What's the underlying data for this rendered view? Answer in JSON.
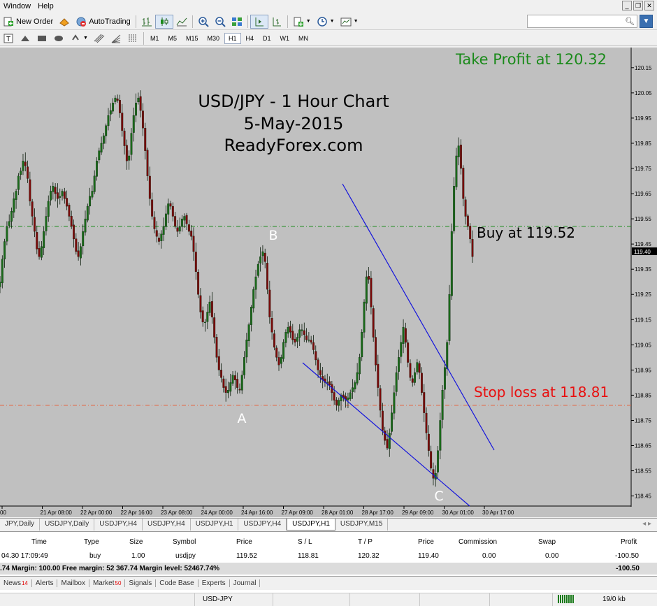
{
  "menu": {
    "items": [
      "Window",
      "Help"
    ]
  },
  "toolbar": {
    "new_order": "New Order",
    "auto_trading": "AutoTrading"
  },
  "timeframes": [
    {
      "label": "M1",
      "active": false
    },
    {
      "label": "M5",
      "active": false
    },
    {
      "label": "M15",
      "active": false
    },
    {
      "label": "M30",
      "active": false
    },
    {
      "label": "H1",
      "active": true
    },
    {
      "label": "H4",
      "active": false
    },
    {
      "label": "D1",
      "active": false
    },
    {
      "label": "W1",
      "active": false
    },
    {
      "label": "MN",
      "active": false
    }
  ],
  "chart": {
    "title_lines": [
      "USD/JPY - 1 Hour Chart",
      "5-May-2015",
      "ReadyForex.com"
    ],
    "take_profit": "Take Profit at 120.32",
    "buy": "Buy at 119.52",
    "stop_loss": "Stop loss at 118.81",
    "point_labels": [
      "A",
      "B",
      "C"
    ],
    "current_price": "119.40",
    "colors": {
      "background": "#c0c0c0",
      "take_profit": "#1a8a1a",
      "buy_line": "#1a8a1a",
      "stop_line": "#e8603a",
      "stop_text": "#e81010",
      "channel": "#1414dc",
      "bull": "#1a6a1a",
      "bear": "#7a0a0a"
    }
  },
  "chart_data": {
    "type": "candlestick",
    "symbol": "USDJPY",
    "timeframe": "H1",
    "y_ticks": [
      "120.15",
      "120.05",
      "119.95",
      "119.85",
      "119.75",
      "119.65",
      "119.55",
      "119.45",
      "119.35",
      "119.25",
      "119.15",
      "119.05",
      "118.95",
      "118.85",
      "118.75",
      "118.65",
      "118.55",
      "118.45"
    ],
    "x_ticks": [
      "00",
      "21 Apr 08:00",
      "22 Apr 00:00",
      "22 Apr 16:00",
      "23 Apr 08:00",
      "24 Apr 00:00",
      "24 Apr 16:00",
      "27 Apr 09:00",
      "28 Apr 01:00",
      "28 Apr 17:00",
      "29 Apr 09:00",
      "30 Apr 01:00",
      "30 Apr 17:00"
    ],
    "ylim": [
      118.41,
      120.23
    ],
    "levels": {
      "take_profit": 120.32,
      "buy": 119.52,
      "stop_loss": 118.81,
      "last": 119.4
    },
    "closes": [
      119.3,
      119.39,
      119.46,
      119.52,
      119.54,
      119.58,
      119.63,
      119.66,
      119.72,
      119.74,
      119.78,
      119.76,
      119.71,
      119.62,
      119.56,
      119.5,
      119.43,
      119.4,
      119.44,
      119.5,
      119.56,
      119.62,
      119.66,
      119.68,
      119.65,
      119.63,
      119.64,
      119.66,
      119.63,
      119.6,
      119.56,
      119.52,
      119.47,
      119.42,
      119.4,
      119.44,
      119.5,
      119.55,
      119.6,
      119.64,
      119.66,
      119.72,
      119.78,
      119.82,
      119.85,
      119.88,
      119.92,
      119.96,
      119.98,
      120.01,
      120.03,
      120.02,
      119.97,
      119.9,
      119.84,
      119.78,
      119.8,
      119.89,
      119.96,
      120.01,
      120.03,
      119.98,
      119.91,
      119.82,
      119.72,
      119.63,
      119.56,
      119.51,
      119.48,
      119.46,
      119.49,
      119.52,
      119.57,
      119.61,
      119.6,
      119.56,
      119.52,
      119.5,
      119.52,
      119.55,
      119.56,
      119.53,
      119.5,
      119.48,
      119.42,
      119.34,
      119.25,
      119.18,
      119.14,
      119.14,
      119.18,
      119.22,
      119.16,
      119.08,
      119.0,
      118.95,
      118.92,
      118.88,
      118.86,
      118.87,
      118.9,
      118.93,
      118.91,
      118.88,
      118.87,
      118.93,
      119.0,
      119.07,
      119.13,
      119.2,
      119.27,
      119.32,
      119.37,
      119.4,
      119.42,
      119.38,
      119.27,
      119.16,
      119.1,
      119.04,
      119.0,
      118.97,
      119.0,
      119.06,
      119.1,
      119.12,
      119.1,
      119.07,
      119.06,
      119.08,
      119.11,
      119.11,
      119.09,
      119.07,
      119.07,
      119.06,
      119.03,
      118.99,
      118.95,
      118.93,
      118.91,
      118.9,
      118.9,
      118.89,
      118.86,
      118.83,
      118.81,
      118.83,
      118.85,
      118.84,
      118.83,
      118.84,
      118.86,
      118.88,
      118.9,
      118.94,
      119.0,
      119.1,
      119.22,
      119.32,
      119.31,
      119.2,
      119.08,
      118.97,
      118.88,
      118.79,
      118.71,
      118.67,
      118.64,
      118.7,
      118.78,
      118.86,
      118.94,
      119.0,
      119.06,
      119.12,
      119.06,
      118.98,
      118.92,
      118.9,
      118.94,
      118.98,
      118.94,
      118.86,
      118.78,
      118.7,
      118.63,
      118.56,
      118.52,
      118.54,
      118.63,
      118.75,
      118.87,
      118.96,
      119.06,
      119.25,
      119.5,
      119.68,
      119.8,
      119.84,
      119.75,
      119.63,
      119.56,
      119.52,
      119.47,
      119.4
    ]
  },
  "chart_tabs": [
    {
      "label": "JPY,Daily",
      "active": false
    },
    {
      "label": "USDJPY,Daily",
      "active": false
    },
    {
      "label": "USDJPY,H4",
      "active": false
    },
    {
      "label": "USDJPY,H4",
      "active": false
    },
    {
      "label": "USDJPY,H1",
      "active": false
    },
    {
      "label": "USDJPY,H4",
      "active": false
    },
    {
      "label": "USDJPY,H1",
      "active": true
    },
    {
      "label": "USDJPY,M15",
      "active": false
    }
  ],
  "terminal": {
    "headers": [
      "Time",
      "Type",
      "Size",
      "Symbol",
      "Price",
      "S / L",
      "T / P",
      "Price",
      "Commission",
      "Swap",
      "Profit"
    ],
    "position": [
      "04.30 17:09:49",
      "buy",
      "1.00",
      "usdjpy",
      "119.52",
      "118.81",
      "120.32",
      "119.40",
      "0.00",
      "0.00",
      "-100.50"
    ],
    "balance_text": ".74  Margin: 100.00  Free margin: 52 367.74  Margin level: 52467.74%",
    "balance_profit": "-100.50",
    "tabs": [
      {
        "label": "News",
        "count": "14"
      },
      {
        "label": "Alerts",
        "count": ""
      },
      {
        "label": "Mailbox",
        "count": ""
      },
      {
        "label": "Market",
        "count": "50"
      },
      {
        "label": "Signals",
        "count": ""
      },
      {
        "label": "Code Base",
        "count": ""
      },
      {
        "label": "Experts",
        "count": ""
      },
      {
        "label": "Journal",
        "count": ""
      }
    ]
  },
  "status": {
    "symbol": "USD-JPY",
    "traffic": "19/0 kb"
  }
}
